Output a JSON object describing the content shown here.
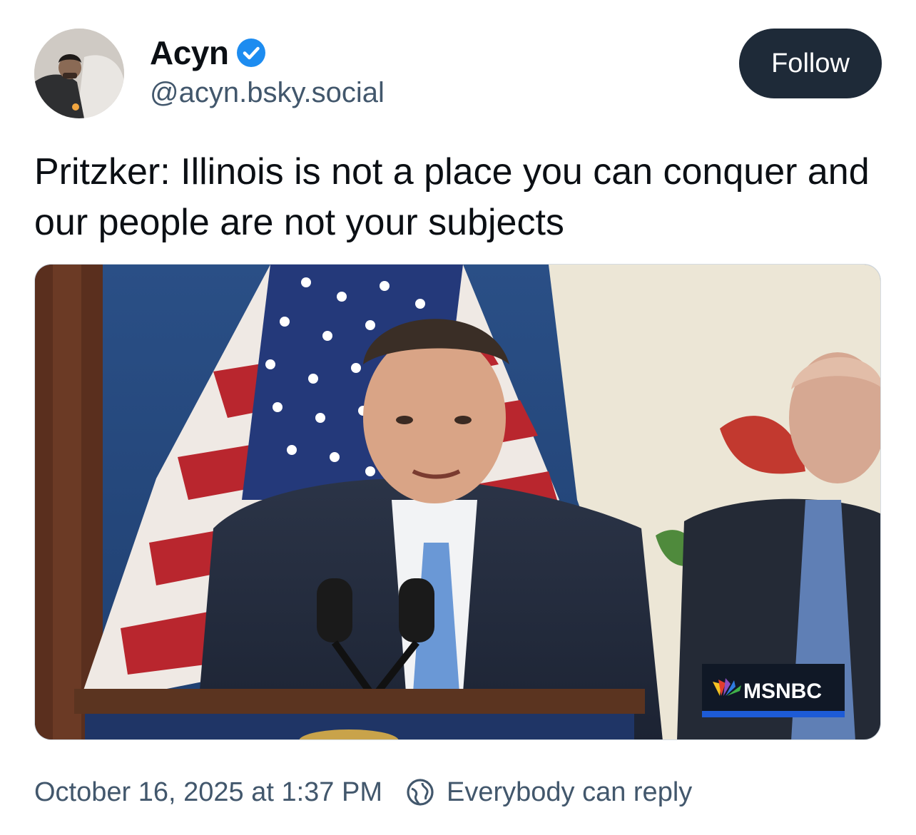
{
  "author": {
    "display_name": "Acyn",
    "handle": "@acyn.bsky.social",
    "verified_icon": "verified-badge-icon",
    "verified_color": "#1d8cf0",
    "avatar": "user-avatar"
  },
  "follow_label": "Follow",
  "post": {
    "text": "Pritzker: Illinois is not a place you can conquer and our people are not your subjects"
  },
  "media": {
    "watermark": "MSNBC",
    "watermark_icon": "peacock-logo-icon"
  },
  "footer": {
    "timestamp": "October 16, 2025 at 1:37 PM",
    "reply_setting": "Everybody can reply",
    "reply_icon": "globe-icon"
  },
  "colors": {
    "follow_bg": "#1e2a38",
    "secondary_text": "#42576c",
    "accent": "#1d8cf0"
  }
}
